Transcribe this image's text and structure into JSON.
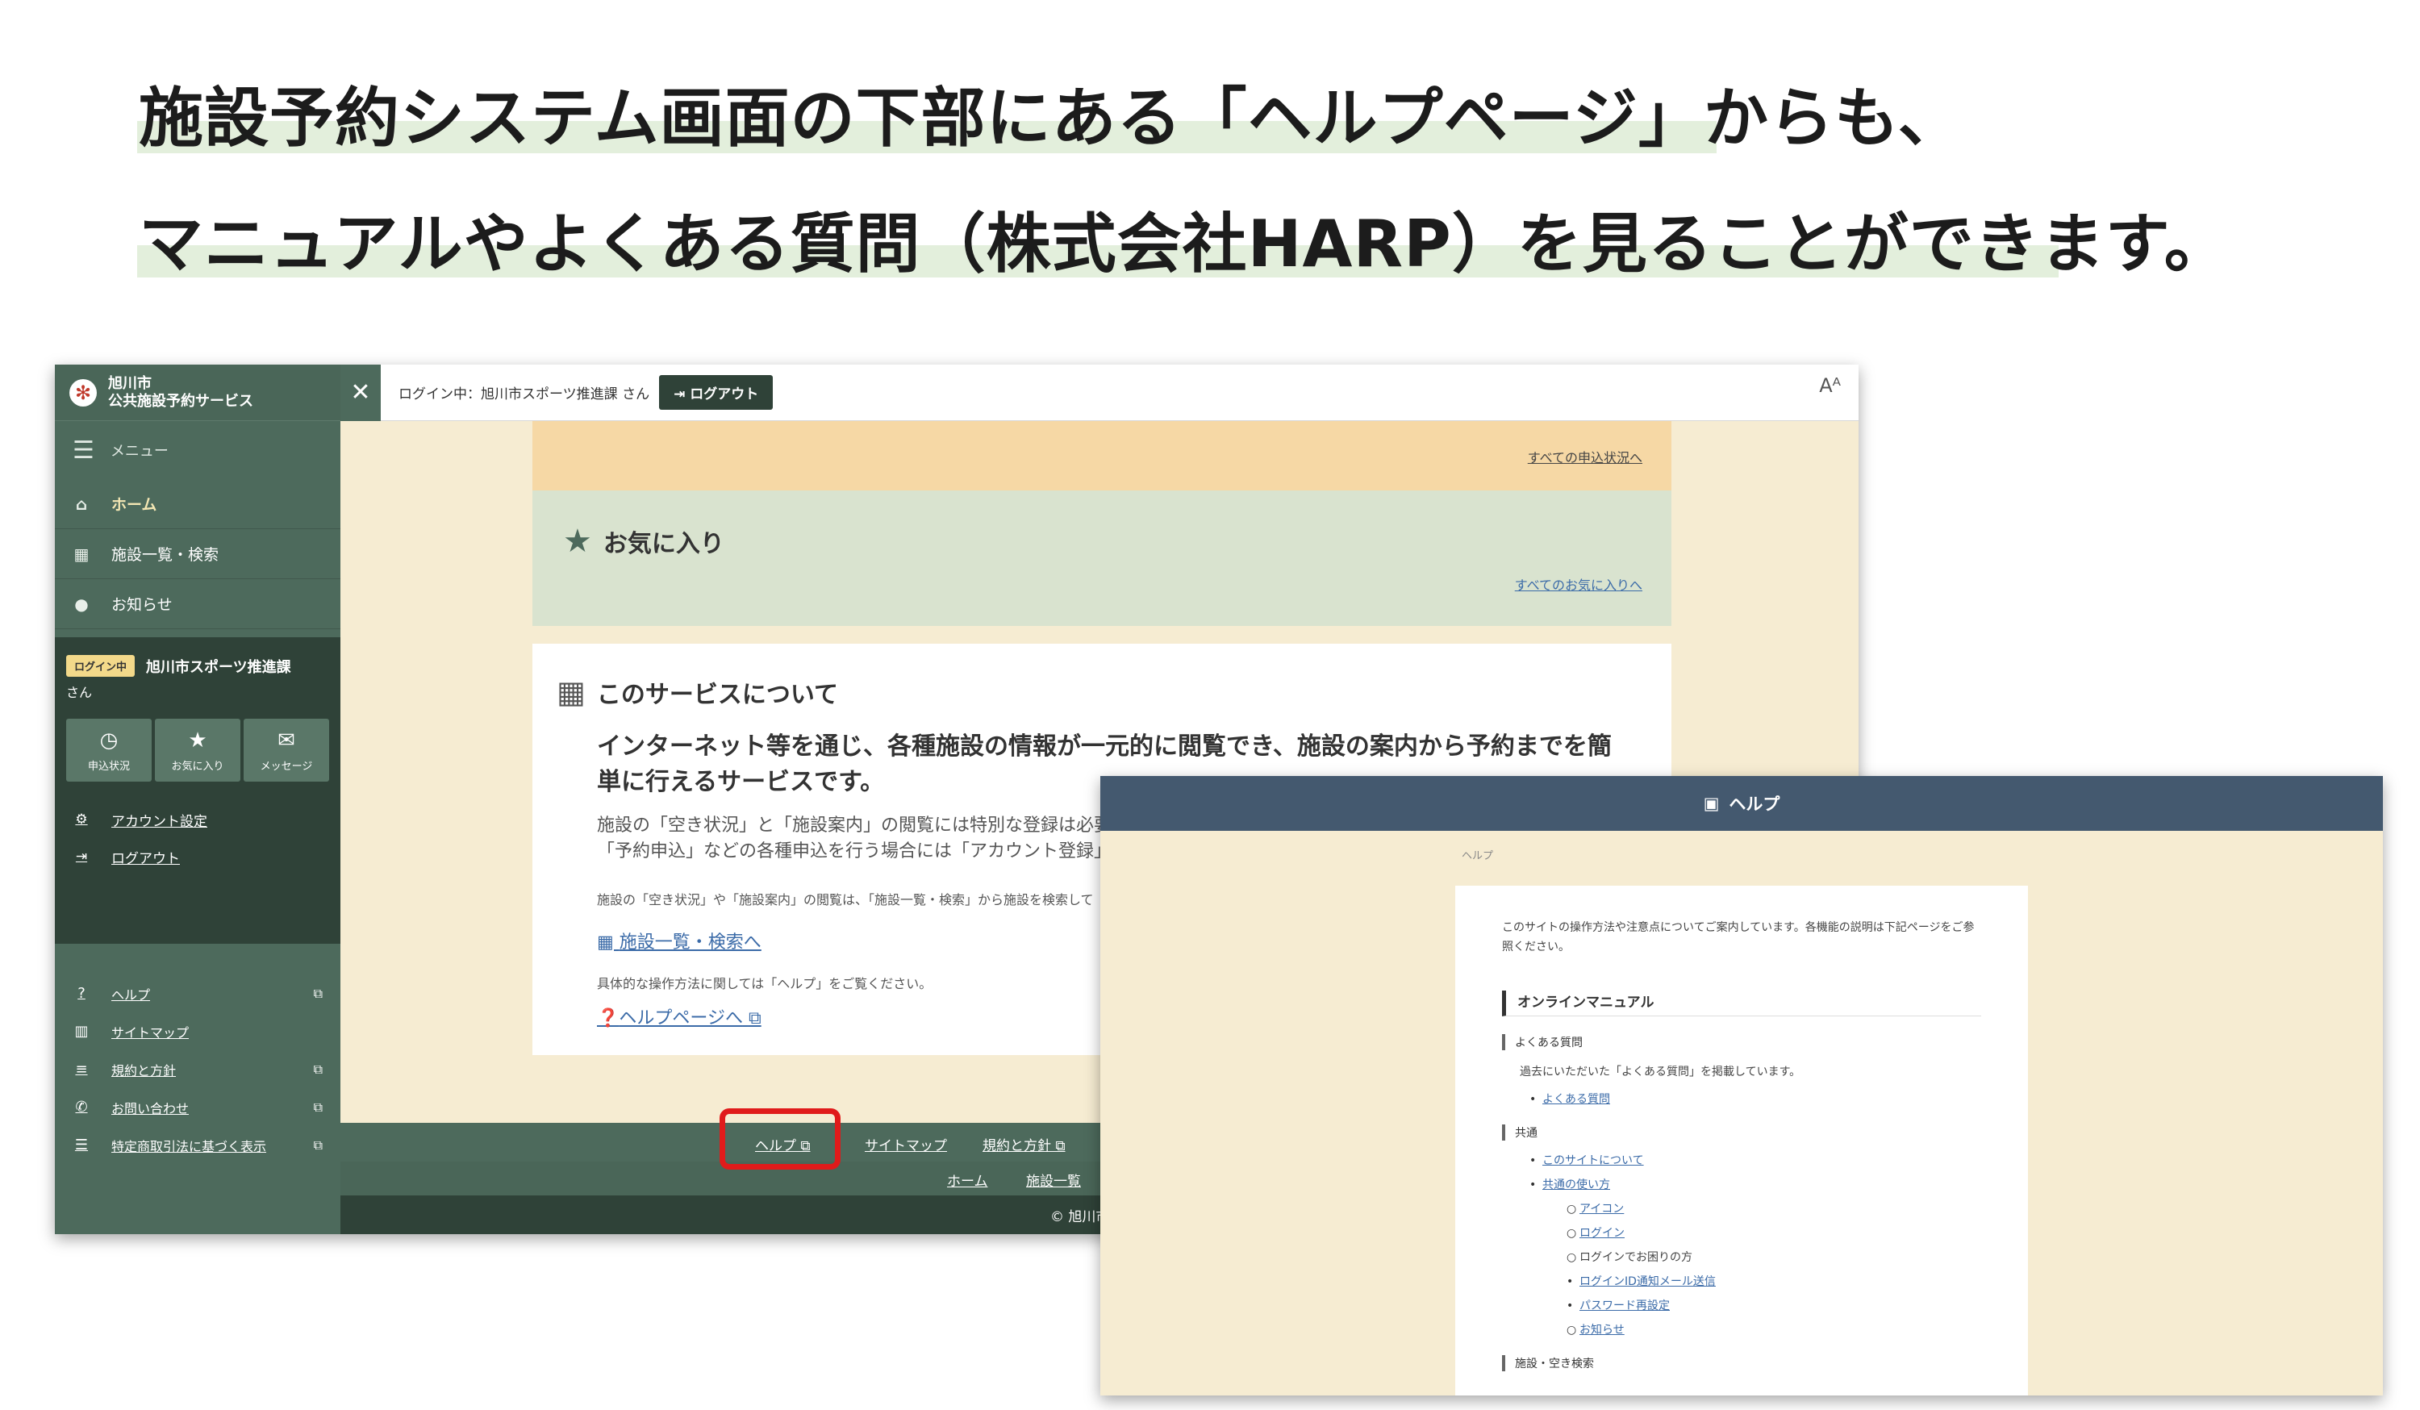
{
  "headline": {
    "line1": "施設予約システム画面の下部にある「ヘルプページ」からも、",
    "line2": "マニュアルやよくある質問（株式会社HARP）を見ることができます。"
  },
  "main": {
    "brand": {
      "line1": "旭川市",
      "line2": "公共施設予約サービス"
    },
    "menu_label": "メニュー",
    "nav": [
      {
        "label": "ホーム",
        "icon": "home-icon"
      },
      {
        "label": "施設一覧・検索",
        "icon": "building-icon"
      },
      {
        "label": "お知らせ",
        "icon": "info-icon"
      }
    ],
    "user": {
      "badge": "ログイン中",
      "name": "旭川市スポーツ推進課",
      "suffix": "さん"
    },
    "quick": [
      {
        "label": "申込状況",
        "icon": "clock-icon"
      },
      {
        "label": "お気に入り",
        "icon": "star-icon"
      },
      {
        "label": "メッセージ",
        "icon": "mail-icon"
      }
    ],
    "account": [
      {
        "label": "アカウント設定",
        "icon": "gear-icon"
      },
      {
        "label": "ログアウト",
        "icon": "logout-icon"
      }
    ],
    "links": [
      {
        "label": "ヘルプ",
        "icon": "question-icon",
        "external": true
      },
      {
        "label": "サイトマップ",
        "icon": "map-icon",
        "external": false
      },
      {
        "label": "規約と方針",
        "icon": "list-icon",
        "external": true
      },
      {
        "label": "お問い合わせ",
        "icon": "phone-icon",
        "external": true
      },
      {
        "label": "特定商取引法に基づく表示",
        "icon": "menu-icon",
        "external": true
      }
    ],
    "topbar": {
      "login_status": "ログイン中：旭川市スポーツ推進課 さん",
      "logout": "ログアウト"
    },
    "applications_link": "すべての申込状況へ",
    "favorites": {
      "title": "お気に入り",
      "link": "すべてのお気に入りへ"
    },
    "service": {
      "title": "このサービスについて",
      "lead": "インターネット等を通じ、各種施設の情報が一元的に閲覧でき、施設の案内から予約までを簡単に行えるサービスです。",
      "desc1": "施設の「空き状況」と「施設案内」の閲覧には特別な登録は必要あ",
      "desc2": "「予約申込」などの各種申込を行う場合には「アカウント登録」が必",
      "note": "施設の「空き状況」や「施設案内」の閲覧は、「施設一覧・検索」から施設を検索して",
      "link1": "施設一覧・検索へ",
      "how": "具体的な操作方法に関しては「ヘルプ」をご覧ください。",
      "link2": "ヘルプページへ"
    },
    "footer": {
      "row1": [
        "ヘルプ",
        "サイトマップ",
        "規約と方針"
      ],
      "row2": [
        "ホーム",
        "施設一覧"
      ],
      "copyright": "© 旭川市公共施"
    }
  },
  "help": {
    "header": "ヘルプ",
    "breadcrumb": "ヘルプ",
    "intro": "このサイトの操作方法や注意点についてご案内しています。各機能の説明は下記ページをご参照ください。",
    "manual_title": "オンラインマニュアル",
    "faq_title": "よくある質問",
    "faq_desc": "過去にいただいた「よくある質問」を掲載しています。",
    "faq_link": "よくある質問",
    "common_title": "共通",
    "common_links": [
      "このサイトについて",
      "共通の使い方"
    ],
    "sub_links": [
      "アイコン",
      "ログイン"
    ],
    "login_trouble": "ログインでお困りの方",
    "login_links": [
      "ログインID通知メール送信",
      "パスワード再設定"
    ],
    "news_link": "お知らせ",
    "facility_title": "施設・空き検索"
  }
}
